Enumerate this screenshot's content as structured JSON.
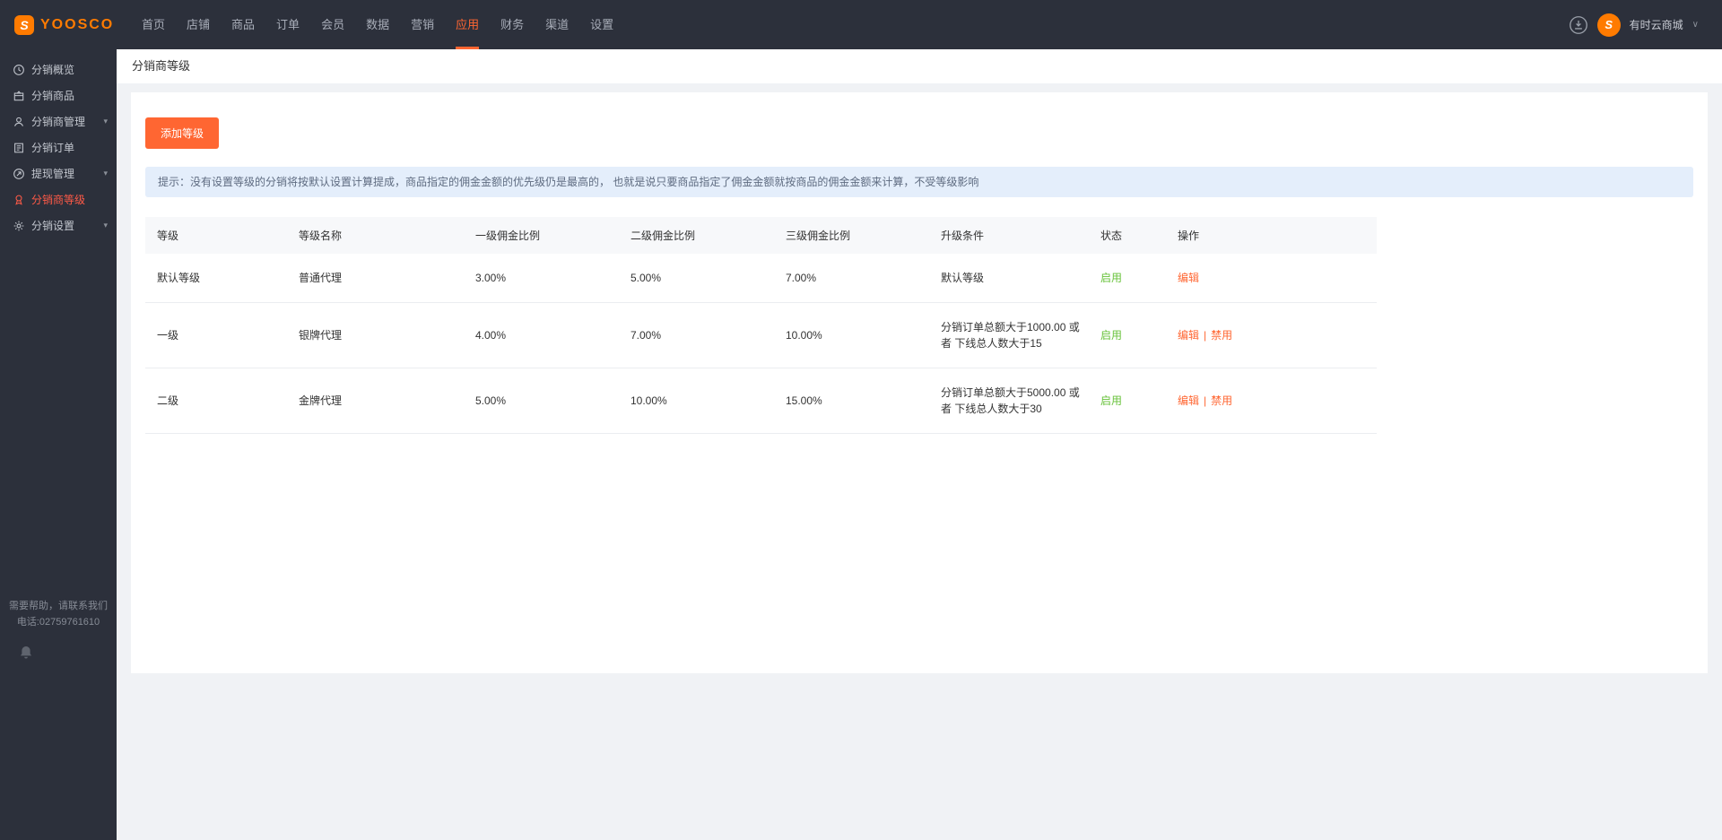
{
  "colors": {
    "topbar_bg": "#2c303b",
    "accent": "#ff6632",
    "brand_orange": "#ff7b00",
    "sidebar_active": "#ff5a47",
    "success_green": "#67c23a",
    "tip_bg": "#e4eefb",
    "page_bg": "#f0f2f5"
  },
  "topbar": {
    "logo_text": "YOOSCO",
    "logo_letter": "S",
    "nav_items": [
      {
        "label": "首页",
        "active": false
      },
      {
        "label": "店铺",
        "active": false
      },
      {
        "label": "商品",
        "active": false
      },
      {
        "label": "订单",
        "active": false
      },
      {
        "label": "会员",
        "active": false
      },
      {
        "label": "数据",
        "active": false
      },
      {
        "label": "营销",
        "active": false
      },
      {
        "label": "应用",
        "active": true
      },
      {
        "label": "财务",
        "active": false
      },
      {
        "label": "渠道",
        "active": false
      },
      {
        "label": "设置",
        "active": false
      }
    ],
    "account": {
      "name": "有时云商城",
      "avatar_letter": "S"
    }
  },
  "sidebar": {
    "items": [
      {
        "label": "分销概览",
        "icon": "clock-icon",
        "expandable": false,
        "active": false
      },
      {
        "label": "分销商品",
        "icon": "goods-icon",
        "expandable": false,
        "active": false
      },
      {
        "label": "分销商管理",
        "icon": "users-icon",
        "expandable": true,
        "active": false
      },
      {
        "label": "分销订单",
        "icon": "order-icon",
        "expandable": false,
        "active": false
      },
      {
        "label": "提现管理",
        "icon": "withdraw-icon",
        "expandable": true,
        "active": false
      },
      {
        "label": "分销商等级",
        "icon": "grade-icon",
        "expandable": false,
        "active": true
      },
      {
        "label": "分销设置",
        "icon": "gear-icon",
        "expandable": true,
        "active": false
      }
    ],
    "help_line1": "需要帮助，请联系我们",
    "help_line2": "电话:02759761610"
  },
  "page": {
    "title": "分销商等级",
    "add_button_label": "添加等级",
    "tip_text": "提示：没有设置等级的分销将按默认设置计算提成，商品指定的佣金金额的优先级仍是最高的， 也就是说只要商品指定了佣金金额就按商品的佣金金额来计算，不受等级影响"
  },
  "table": {
    "headers": [
      "等级",
      "等级名称",
      "一级佣金比例",
      "二级佣金比例",
      "三级佣金比例",
      "升级条件",
      "状态",
      "操作"
    ],
    "rows": [
      {
        "cells": [
          "默认等级",
          "普通代理",
          "3.00%",
          "5.00%",
          "7.00%",
          "默认等级"
        ],
        "status": "启用",
        "actions": [
          "编辑"
        ]
      },
      {
        "cells": [
          "一级",
          "银牌代理",
          "4.00%",
          "7.00%",
          "10.00%",
          "分销订单总额大于1000.00 或者 下线总人数大于15"
        ],
        "status": "启用",
        "actions": [
          "编辑",
          "禁用"
        ]
      },
      {
        "cells": [
          "二级",
          "金牌代理",
          "5.00%",
          "10.00%",
          "15.00%",
          "分销订单总额大于5000.00 或者 下线总人数大于30"
        ],
        "status": "启用",
        "actions": [
          "编辑",
          "禁用"
        ]
      }
    ]
  }
}
